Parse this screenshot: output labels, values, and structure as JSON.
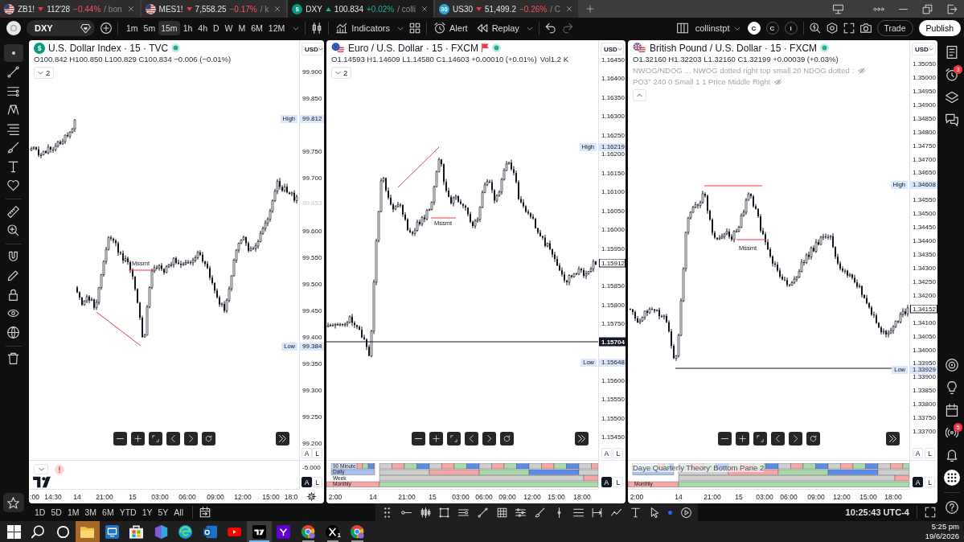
{
  "tabs": [
    {
      "logo": {
        "kind": "flag"
      },
      "symbol": "ZB1!",
      "rising": false,
      "price": "112'28",
      "change": "−0.44%",
      "layout": "/ bon",
      "selected": false
    },
    {
      "logo": {
        "kind": "flag"
      },
      "symbol": "MES1!",
      "rising": false,
      "price": "7,558.25",
      "change": "−0.17%",
      "layout": "/ k",
      "selected": false
    },
    {
      "logo": {
        "kind": "badge",
        "text": "$",
        "color": "#089981"
      },
      "symbol": "DXY",
      "rising": true,
      "price": "100.834",
      "change": "+0.02%",
      "layout": "/ colli",
      "selected": true
    },
    {
      "logo": {
        "kind": "badge",
        "text": "30",
        "color": "#2aa7e0"
      },
      "symbol": "US30",
      "rising": false,
      "price": "51,499.2",
      "change": "−0.26%",
      "layout": "/ C",
      "selected": false
    }
  ],
  "toolbar": {
    "symbol": "DXY",
    "intervals": [
      {
        "label": "1m",
        "selected": false
      },
      {
        "label": "5m",
        "selected": false
      },
      {
        "label": "15m",
        "selected": true
      },
      {
        "label": "1h",
        "selected": false
      },
      {
        "label": "4h",
        "selected": false
      },
      {
        "label": "D",
        "selected": false
      },
      {
        "label": "W",
        "selected": false
      },
      {
        "label": "M",
        "selected": false
      },
      {
        "label": "6M",
        "selected": false
      },
      {
        "label": "12M",
        "selected": false
      }
    ],
    "indicators": "Indicators",
    "alert": "Alert",
    "replay": "Replay",
    "layout_name": "collinstpt",
    "profiles": [
      {
        "label": "C",
        "selected": true
      },
      {
        "label": "C",
        "selected": false
      },
      {
        "label": "I",
        "selected": false
      }
    ],
    "trade": "Trade",
    "publish": "Publish"
  },
  "left_toolbar": [
    {
      "selected": true
    },
    {
      "selected": false
    },
    {
      "selected": false
    },
    {
      "selected": false
    },
    {
      "selected": false
    },
    {
      "selected": false
    },
    {
      "selected": false
    },
    {
      "selected": false
    },
    {
      "selected": false
    },
    {
      "selected": false
    },
    {
      "selected": false
    },
    {
      "selected": false
    },
    {
      "selected": false
    },
    {
      "selected": false
    },
    {
      "selected": false
    },
    {
      "selected": false
    }
  ],
  "panes": [
    {
      "logo": {
        "kind": "badge",
        "text": "$",
        "color": "#089981"
      },
      "title": "U.S. Dollar Index · 15 · TVC",
      "flagged": false,
      "market_open": true,
      "ohlc": "O100.842 H100.850 L100.829 C100.834 −0.006 (−0.01%)",
      "legend": {
        "expanded": false,
        "count": "2"
      },
      "currency": "USD",
      "price_ticks": [
        "99.900",
        "99.850",
        "99.750",
        "99.700",
        "99.600",
        "99.550",
        "99.500",
        "99.450",
        "99.400",
        "99.350",
        "99.300",
        "99.250",
        "99.200"
      ],
      "price_labels": [
        {
          "kind": "high",
          "label": "High",
          "value": "99.812"
        },
        {
          "kind": "faded",
          "value": "99.653"
        },
        {
          "kind": "low",
          "label": "Low",
          "value": "99.384"
        }
      ],
      "annotations": [
        "Mssmt"
      ],
      "scale_buttons": [
        {
          "label": "A",
          "selected": false
        },
        {
          "label": "L",
          "selected": false
        }
      ],
      "sub_pane": {
        "kind": "oscillator",
        "ticks": [
          "-5.000"
        ],
        "scale_buttons": [
          {
            "label": "A",
            "selected": true
          },
          {
            "label": "L",
            "selected": false
          }
        ]
      },
      "time_ticks": [
        ":00",
        "14:30",
        "14",
        "21:00",
        "15",
        "03:00",
        "06:00",
        "09:00",
        "12:00",
        "15:00",
        "18:0"
      ]
    },
    {
      "logo": {
        "kind": "eu_us"
      },
      "title": "Euro / U.S. Dollar · 15 · FXCM",
      "flagged": true,
      "market_open": true,
      "ohlc": "O1.14593 H1.14609 L1.14580 C1.14603 +0.00010 (+0.01%)",
      "volume": "Vol1.2 K",
      "legend": {
        "expanded": false,
        "count": "2"
      },
      "currency": "USD",
      "price_ticks": [
        "1.16450",
        "1.16400",
        "1.16350",
        "1.16300",
        "1.16250",
        "1.16200",
        "1.16150",
        "1.16100",
        "1.16050",
        "1.16000",
        "1.15950",
        "1.15850",
        "1.15800",
        "1.15750",
        "1.15600",
        "1.15550",
        "1.15500",
        "1.15450"
      ],
      "price_labels": [
        {
          "kind": "high",
          "label": "High",
          "value": "1.16219"
        },
        {
          "kind": "last",
          "value": "1.15912"
        },
        {
          "kind": "line",
          "value": "1.15704"
        },
        {
          "kind": "low",
          "label": "Low",
          "value": "1.15648"
        }
      ],
      "annotations": [
        "Mssmt"
      ],
      "scale_buttons": [
        {
          "label": "A",
          "selected": false
        },
        {
          "label": "L",
          "selected": false
        }
      ],
      "sub_pane": {
        "kind": "quarterly",
        "row_labels": [
          "90 Minute",
          "Daily",
          "Week",
          "Monthly"
        ],
        "scale_buttons": [
          {
            "label": "A",
            "selected": true
          },
          {
            "label": "L",
            "selected": false
          }
        ]
      },
      "time_ticks": [
        "2:00",
        "14",
        "21:00",
        "15",
        "03:00",
        "06:00",
        "09:00",
        "12:00",
        "15:00",
        "18:00"
      ]
    },
    {
      "logo": {
        "kind": "gb_us"
      },
      "title": "British Pound / U.S. Dollar · 15 · FXCM",
      "flagged": false,
      "market_open": true,
      "ohlc": "O1.32160 H1.32203 L1.32160 C1.32199 +0.00039 (+0.03%)",
      "indicators": [
        {
          "text": "NWOG/NDOG ... NWOG dotted right top small 20 NDOG dotted :",
          "hidden": true
        },
        {
          "text": "PO3° 240 0 Small 1 1 Price Middle Right",
          "hidden": true
        }
      ],
      "legend": {
        "expanded": true
      },
      "currency": "USD",
      "price_ticks": [
        "1.35050",
        "1.35000",
        "1.34950",
        "1.34900",
        "1.34850",
        "1.34800",
        "1.34750",
        "1.34700",
        "1.34650",
        "1.34550",
        "1.34500",
        "1.34450",
        "1.34400",
        "1.34350",
        "1.34300",
        "1.34250",
        "1.34200",
        "1.34100",
        "1.34050",
        "1.34000",
        "1.33950",
        "1.33900",
        "1.33850",
        "1.33800",
        "1.33750",
        "1.33700"
      ],
      "price_labels": [
        {
          "kind": "high",
          "label": "High",
          "value": "1.34608"
        },
        {
          "kind": "last",
          "value": "1.34152"
        },
        {
          "kind": "low",
          "label": "Low",
          "value": "1.33929"
        }
      ],
      "annotations": [
        "Mssmt"
      ],
      "scale_buttons": [
        {
          "label": "A",
          "selected": false
        },
        {
          "label": "L",
          "selected": false
        }
      ],
      "sub_pane": {
        "kind": "quarterly",
        "title": "Daye Quarterly Theory' Bottom Pane 2",
        "row_labels": [
          "Monthly"
        ],
        "scale_buttons": [
          {
            "label": "A",
            "selected": true
          },
          {
            "label": "L",
            "selected": false
          }
        ]
      },
      "time_ticks": [
        "2:00",
        "14",
        "21:00",
        "15",
        "03:00",
        "06:00",
        "09:00",
        "12:00",
        "15:00",
        "18:00"
      ]
    }
  ],
  "right_sidebar": {
    "alerts_badge": "3",
    "notifications_badge": "5"
  },
  "bottom_bar": {
    "ranges": [
      "1D",
      "5D",
      "1M",
      "3M",
      "6M",
      "YTD",
      "1Y",
      "5Y",
      "All"
    ],
    "clock": "10:25:43 UTC-4"
  },
  "taskbar": {
    "apps": [
      {
        "selected": false,
        "running": false,
        "flashing": false
      },
      {
        "selected": false,
        "running": false,
        "flashing": false
      },
      {
        "selected": false,
        "running": false,
        "flashing": false
      },
      {
        "selected": false,
        "running": false,
        "flashing": true
      },
      {
        "selected": false,
        "running": false,
        "flashing": false
      },
      {
        "selected": false,
        "running": false,
        "flashing": false
      },
      {
        "selected": false,
        "running": false,
        "flashing": false
      },
      {
        "selected": false,
        "running": false,
        "flashing": false
      },
      {
        "selected": false,
        "running": false,
        "flashing": false
      },
      {
        "selected": false,
        "running": false,
        "flashing": false
      },
      {
        "selected": true,
        "running": true,
        "flashing": false
      },
      {
        "selected": false,
        "running": false,
        "flashing": false
      },
      {
        "selected": false,
        "running": true,
        "flashing": false
      },
      {
        "selected": false,
        "running": true,
        "flashing": false,
        "badge": "1"
      },
      {
        "selected": false,
        "running": true,
        "flashing": false
      }
    ],
    "time": "5:25 pm",
    "date": "19/6/2026"
  }
}
